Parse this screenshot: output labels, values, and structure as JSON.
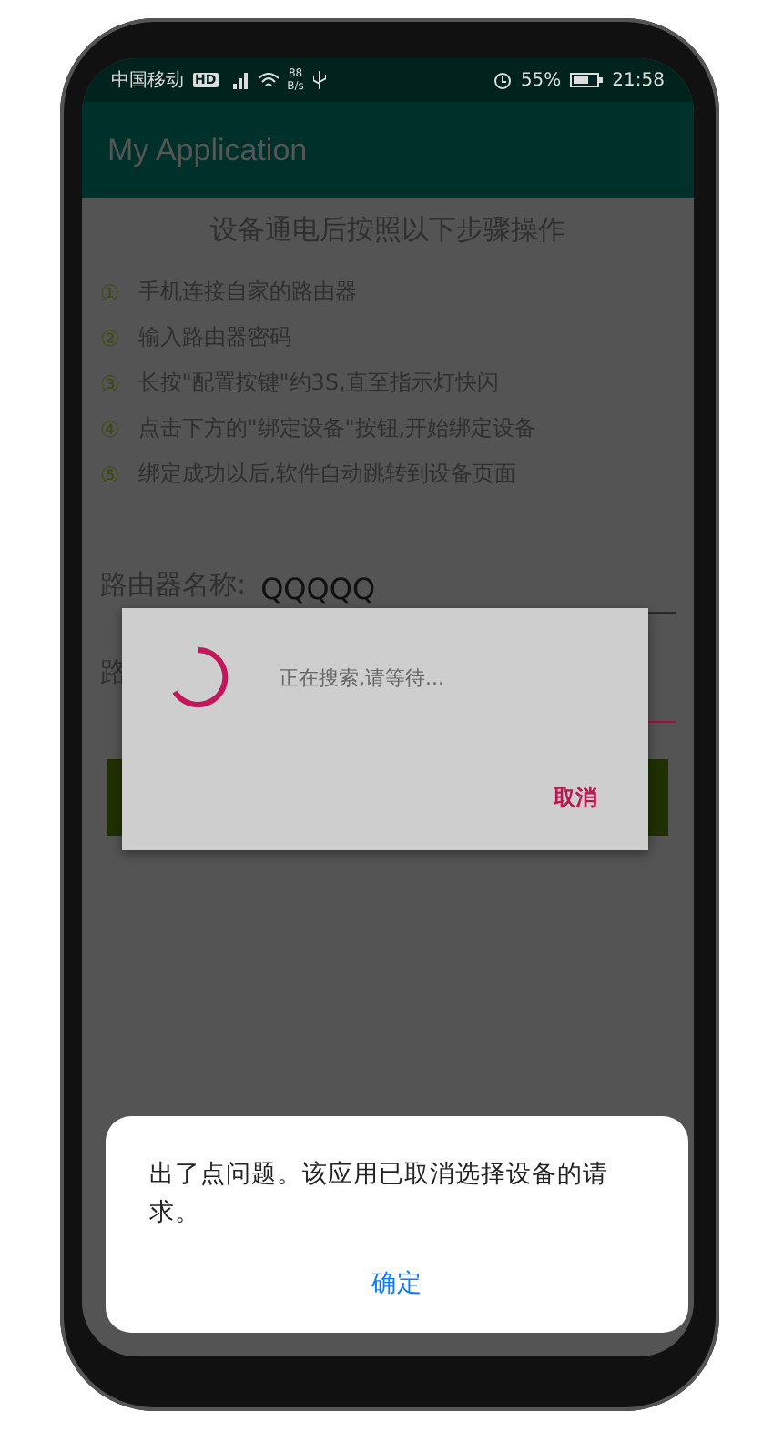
{
  "status_bar": {
    "carrier": "中国移动",
    "hd_badge": "HD",
    "speed_value": "88",
    "speed_unit": "B/s",
    "battery": "55%",
    "time": "21:58"
  },
  "app_bar": {
    "title": "My Application"
  },
  "instructions": {
    "heading": "设备通电后按照以下步骤操作",
    "steps": [
      {
        "number": "①",
        "text": "手机连接自家的路由器"
      },
      {
        "number": "②",
        "text": "输入路由器密码"
      },
      {
        "number": "③",
        "text": "长按\"配置按键\"约3S,直至指示灯快闪"
      },
      {
        "number": "④",
        "text": "点击下方的\"绑定设备\"按钮,开始绑定设备"
      },
      {
        "number": "⑤",
        "text": "绑定成功以后,软件自动跳转到设备页面"
      }
    ]
  },
  "form": {
    "fields": [
      {
        "label": "路由器名称:",
        "value": "QQQQQ",
        "focused": false
      },
      {
        "label": "路",
        "focused": true
      }
    ]
  },
  "progress_dialog": {
    "message": "正在搜索,请等待...",
    "button": "取消"
  },
  "alert": {
    "message": "出了点问题。该应用已取消选择设备的请求。",
    "button": "确定"
  }
}
